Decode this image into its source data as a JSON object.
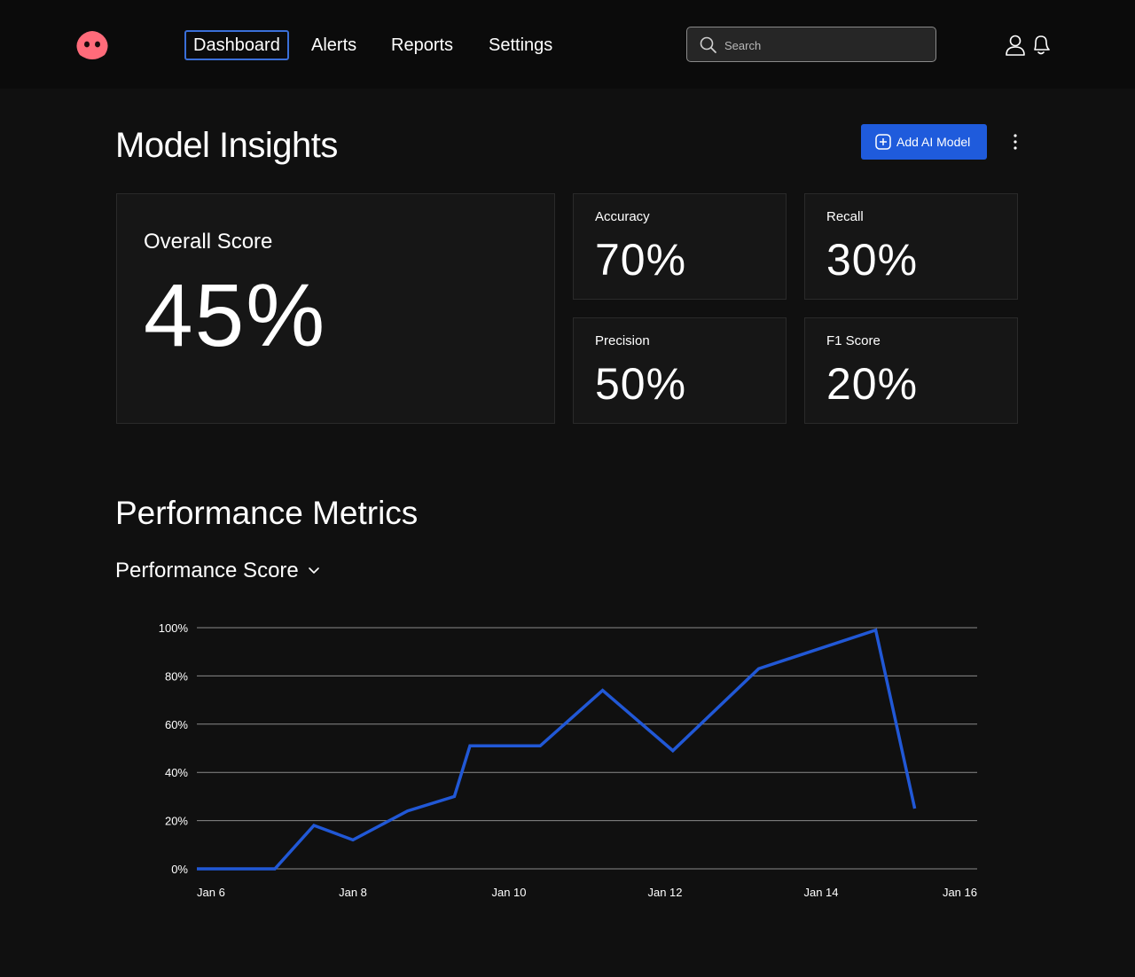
{
  "nav": {
    "items": [
      {
        "label": "Dashboard",
        "active": true
      },
      {
        "label": "Alerts",
        "active": false
      },
      {
        "label": "Reports",
        "active": false
      },
      {
        "label": "Settings",
        "active": false
      }
    ],
    "search_placeholder": "Search"
  },
  "colors": {
    "accent": "#1f5bdc",
    "logo": "#ff6b7a",
    "line": "#2158d6",
    "background": "#101010"
  },
  "header": {
    "title": "Model Insights",
    "add_button_label": "Add AI Model"
  },
  "metrics": {
    "overall": {
      "label": "Overall Score",
      "value": "45%"
    },
    "accuracy": {
      "label": "Accuracy",
      "value": "70%"
    },
    "recall": {
      "label": "Recall",
      "value": "30%"
    },
    "precision": {
      "label": "Precision",
      "value": "50%"
    },
    "f1": {
      "label": "F1 Score",
      "value": "20%"
    }
  },
  "performance": {
    "title": "Performance Metrics",
    "selector_label": "Performance Score"
  },
  "chart_data": {
    "type": "line",
    "title": "",
    "xlabel": "",
    "ylabel": "",
    "ylim": [
      0,
      100
    ],
    "yticks": [
      "0%",
      "20%",
      "40%",
      "60%",
      "80%",
      "100%"
    ],
    "xticks": [
      "Jan 6",
      "Jan 8",
      "Jan 10",
      "Jan 12",
      "Jan 14",
      "Jan 16"
    ],
    "xlim": [
      6,
      16
    ],
    "grid": true,
    "series": [
      {
        "x": [
          6,
          7,
          7.5,
          8,
          8.7,
          9.3,
          9.5,
          10.4,
          11.2,
          12.1,
          13.2,
          14.7,
          15.2
        ],
        "values": [
          0,
          0,
          18,
          12,
          24,
          30,
          51,
          51,
          74,
          49,
          83,
          99,
          25
        ]
      }
    ]
  }
}
